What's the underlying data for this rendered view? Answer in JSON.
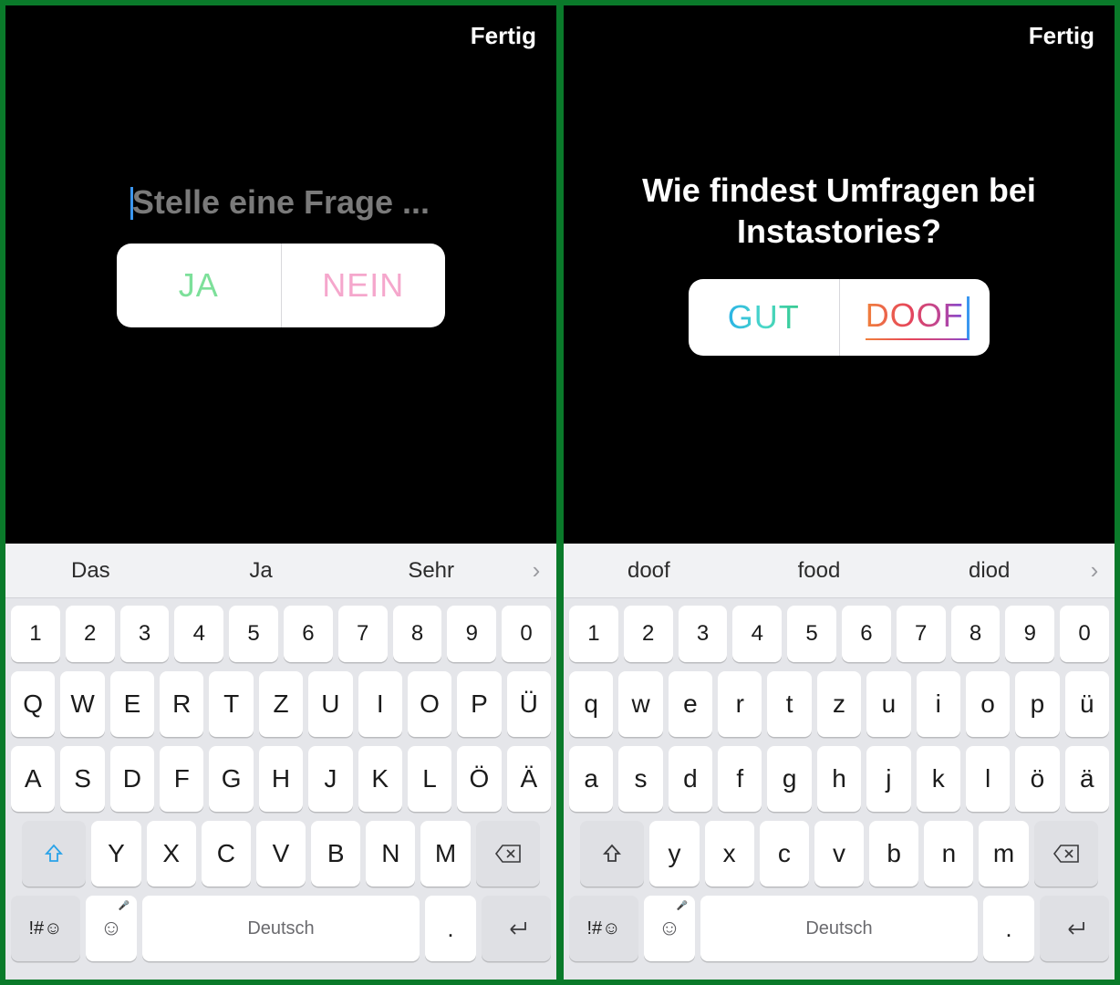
{
  "left": {
    "done": "Fertig",
    "question_placeholder": "Stelle eine Frage ...",
    "poll": {
      "opt1": "JA",
      "opt2": "NEIN"
    },
    "suggestions": [
      "Das",
      "Ja",
      "Sehr"
    ],
    "keyboard": {
      "numrow": [
        "1",
        "2",
        "3",
        "4",
        "5",
        "6",
        "7",
        "8",
        "9",
        "0"
      ],
      "row1": [
        "Q",
        "W",
        "E",
        "R",
        "T",
        "Z",
        "U",
        "I",
        "O",
        "P",
        "Ü"
      ],
      "row2": [
        "A",
        "S",
        "D",
        "F",
        "G",
        "H",
        "J",
        "K",
        "L",
        "Ö",
        "Ä"
      ],
      "row3": [
        "Y",
        "X",
        "C",
        "V",
        "B",
        "N",
        "M"
      ],
      "sym": "!#☺",
      "space": "Deutsch",
      "period": "."
    }
  },
  "right": {
    "done": "Fertig",
    "question_text": "Wie findest Umfragen bei Instastories?",
    "poll": {
      "opt1": "GUT",
      "opt2": "DOOF"
    },
    "suggestions": [
      "doof",
      "food",
      "diod"
    ],
    "keyboard": {
      "numrow": [
        "1",
        "2",
        "3",
        "4",
        "5",
        "6",
        "7",
        "8",
        "9",
        "0"
      ],
      "row1": [
        "q",
        "w",
        "e",
        "r",
        "t",
        "z",
        "u",
        "i",
        "o",
        "p",
        "ü"
      ],
      "row2": [
        "a",
        "s",
        "d",
        "f",
        "g",
        "h",
        "j",
        "k",
        "l",
        "ö",
        "ä"
      ],
      "row3": [
        "y",
        "x",
        "c",
        "v",
        "b",
        "n",
        "m"
      ],
      "sym": "!#☺",
      "space": "Deutsch",
      "period": "."
    }
  }
}
